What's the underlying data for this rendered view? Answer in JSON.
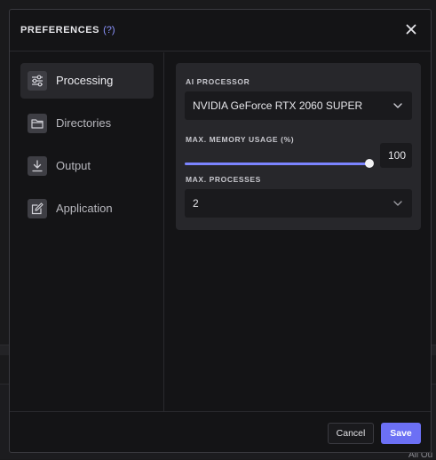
{
  "background": {
    "corner_text": "All Ou"
  },
  "modal": {
    "title": "PREFERENCES",
    "help": "(?)",
    "close_icon": "close-icon"
  },
  "sidebar": {
    "items": [
      {
        "label": "Processing",
        "icon": "sliders-icon",
        "active": true
      },
      {
        "label": "Directories",
        "icon": "folder-icon",
        "active": false
      },
      {
        "label": "Output",
        "icon": "download-icon",
        "active": false
      },
      {
        "label": "Application",
        "icon": "edit-icon",
        "active": false
      }
    ]
  },
  "processing": {
    "ai_processor": {
      "label": "AI PROCESSOR",
      "value": "NVIDIA GeForce RTX 2060 SUPER"
    },
    "memory": {
      "label": "MAX. MEMORY USAGE (%)",
      "value": "100",
      "fraction": 1.0
    },
    "processes": {
      "label": "MAX. PROCESSES",
      "value": "2"
    }
  },
  "footer": {
    "cancel_label": "Cancel",
    "save_label": "Save"
  },
  "colors": {
    "accent": "#6c70f5",
    "slider": "#7b84ff",
    "modal_bg": "#141416",
    "panel_bg": "#27272b"
  }
}
